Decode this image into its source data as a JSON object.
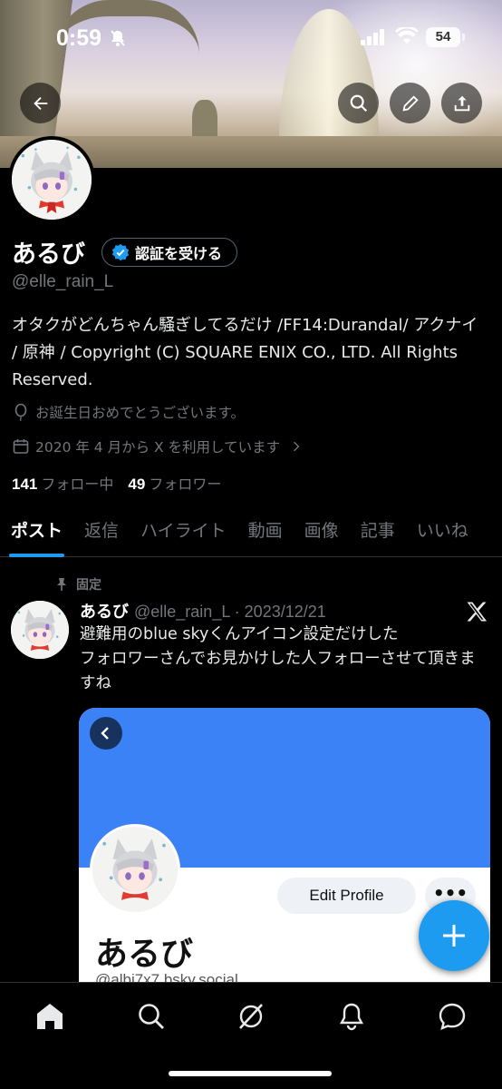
{
  "status_bar": {
    "time": "0:59",
    "battery": "54"
  },
  "profile": {
    "name": "あるび",
    "verify_label": "認証を受ける",
    "handle": "@elle_rain_L",
    "bio": "オタクがどんちゃん騒ぎしてるだけ /FF14:Durandal/ アクナイ / 原神 / Copyright (C) SQUARE ENIX CO., LTD. All Rights Reserved.",
    "birthday": "お誕生日おめでとうございます。",
    "joined": "2020 年 4 月から X を利用しています",
    "following_count": "141",
    "following_label": "フォロー中",
    "followers_count": "49",
    "followers_label": "フォロワー"
  },
  "tabs": [
    "ポスト",
    "返信",
    "ハイライト",
    "動画",
    "画像",
    "記事",
    "いいね"
  ],
  "pinned_post": {
    "pinned_label": "固定",
    "name": "あるび",
    "handle_date": "@elle_rain_L · 2023/12/21",
    "text": "避難用のblue skyくんアイコン設定だけした\nフォロワーさんでお見かけした人フォローさせて頂きますね",
    "card": {
      "edit_profile": "Edit Profile",
      "more": "•••",
      "name": "あるび",
      "handle": "@albi7x7.bsky.social"
    }
  },
  "colors": {
    "accent": "#1d9bf0",
    "card_blue": "#3b82f6",
    "background": "#000000"
  },
  "icons": [
    "back-arrow-icon",
    "search-icon",
    "edit-pencil-icon",
    "share-icon",
    "verified-badge-icon",
    "balloon-icon",
    "calendar-icon",
    "pin-icon",
    "x-logo-icon",
    "plus-icon",
    "home-icon",
    "explore-icon",
    "grok-icon",
    "notifications-icon",
    "messages-icon"
  ]
}
